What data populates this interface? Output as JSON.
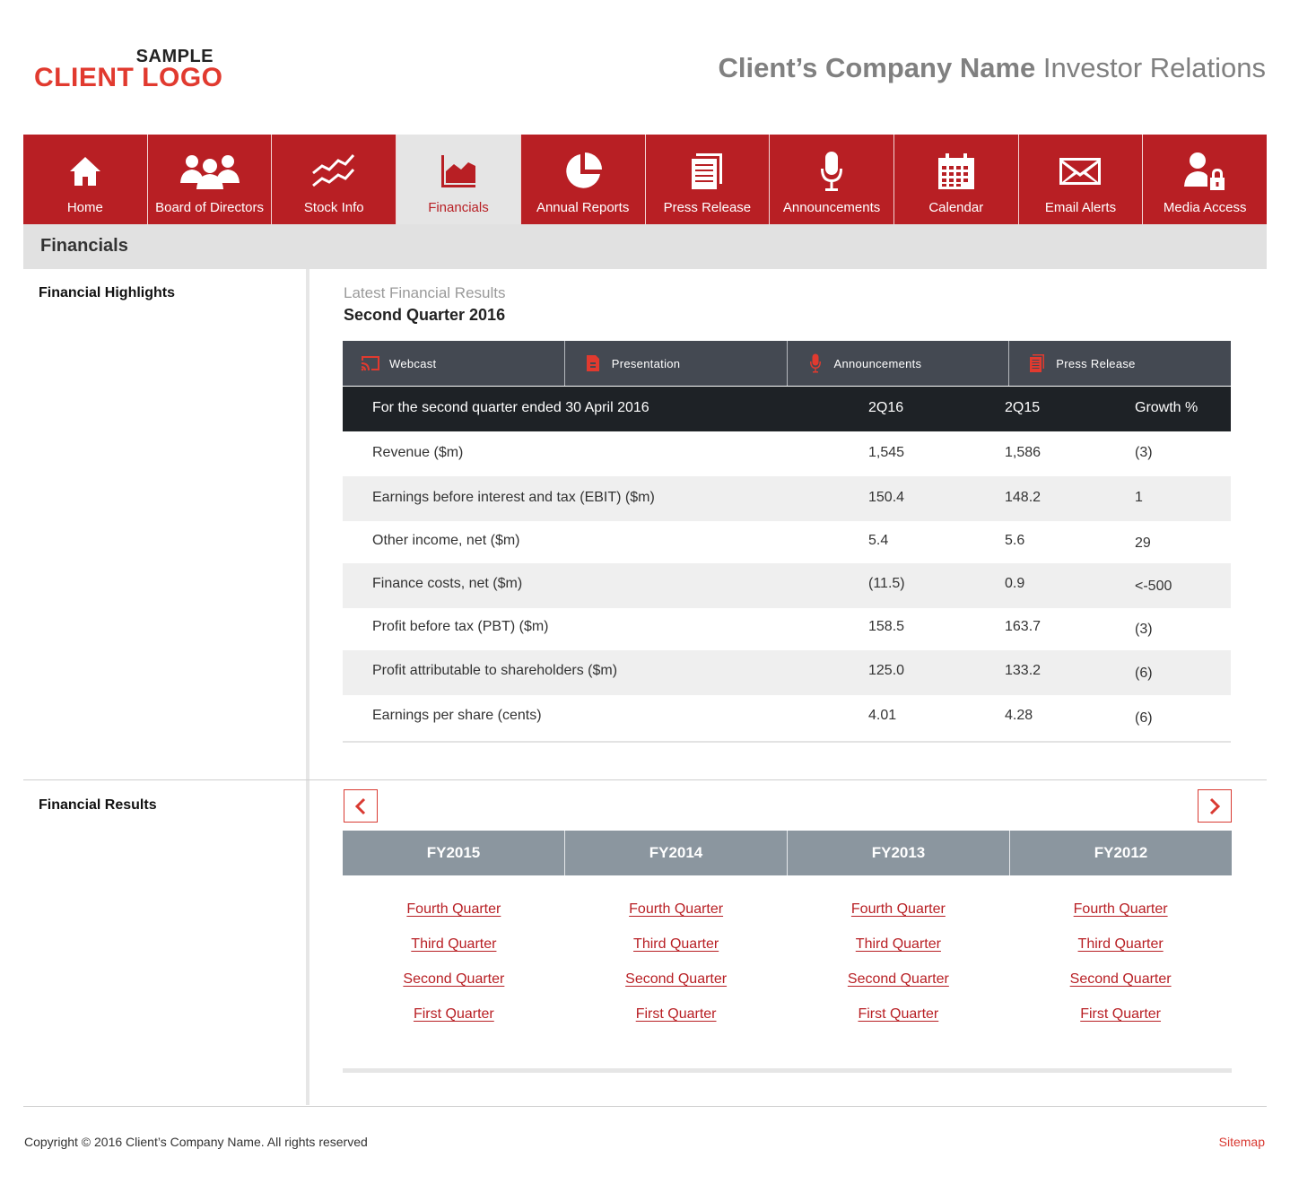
{
  "logo": {
    "line1": "SAMPLE",
    "line2": "CLIENT LOGO"
  },
  "site_title": {
    "bold": "Client’s Company Name",
    "rest": " Investor Relations"
  },
  "nav": [
    {
      "label": "Home",
      "icon": "home-icon"
    },
    {
      "label": "Board of Directors",
      "icon": "people-icon"
    },
    {
      "label": "Stock Info",
      "icon": "stock-chart-icon"
    },
    {
      "label": "Financials",
      "icon": "area-chart-icon",
      "active": true
    },
    {
      "label": "Annual Reports",
      "icon": "pie-chart-icon"
    },
    {
      "label": "Press Release",
      "icon": "document-icon"
    },
    {
      "label": "Announcements",
      "icon": "microphone-icon"
    },
    {
      "label": "Calendar",
      "icon": "calendar-icon"
    },
    {
      "label": "Email Alerts",
      "icon": "envelope-icon"
    },
    {
      "label": "Media Access",
      "icon": "user-lock-icon"
    }
  ],
  "page_heading": "Financials",
  "highlights": {
    "label": "Financial Highlights",
    "latest_title": "Latest Financial Results",
    "latest_sub": "Second Quarter 2016",
    "tools": [
      {
        "label": "Webcast",
        "icon": "webcast-icon"
      },
      {
        "label": "Presentation",
        "icon": "presentation-file-icon"
      },
      {
        "label": "Announcements",
        "icon": "microphone-icon"
      },
      {
        "label": "Press Release",
        "icon": "document-icon"
      }
    ],
    "table": {
      "header": [
        "For the second quarter ended 30 April 2016",
        "2Q16",
        "2Q15",
        "Growth %"
      ],
      "rows": [
        [
          "Revenue ($m)",
          "1,545",
          "1,586",
          "(3)"
        ],
        [
          "Earnings before interest and tax (EBIT) ($m)",
          "150.4",
          "148.2",
          "1"
        ],
        [
          "Other income, net ($m)",
          "5.4",
          "5.6",
          "29"
        ],
        [
          "Finance costs, net ($m)",
          "(11.5)",
          "0.9",
          "<-500"
        ],
        [
          "Profit before tax (PBT) ($m)",
          "158.5",
          "163.7",
          "(3)"
        ],
        [
          "Profit attributable to shareholders ($m)",
          "125.0",
          "133.2",
          "(6)"
        ],
        [
          "Earnings per share (cents)",
          "4.01",
          "4.28",
          "(6)"
        ]
      ]
    }
  },
  "results": {
    "label": "Financial Results",
    "years": [
      "FY2015",
      "FY2014",
      "FY2013",
      "FY2012"
    ],
    "quarters": [
      "Fourth Quarter",
      "Third Quarter",
      "Second Quarter",
      "First Quarter"
    ]
  },
  "footer": {
    "copyright": "Copyright © 2016 Client’s Company Name. All rights reserved",
    "sitemap": "Sitemap"
  },
  "colors": {
    "brand_red": "#b81f24",
    "accent_red": "#e13a2f",
    "dark": "#1e2226",
    "tool_bar": "#444952",
    "year_bar": "#8b969f"
  }
}
